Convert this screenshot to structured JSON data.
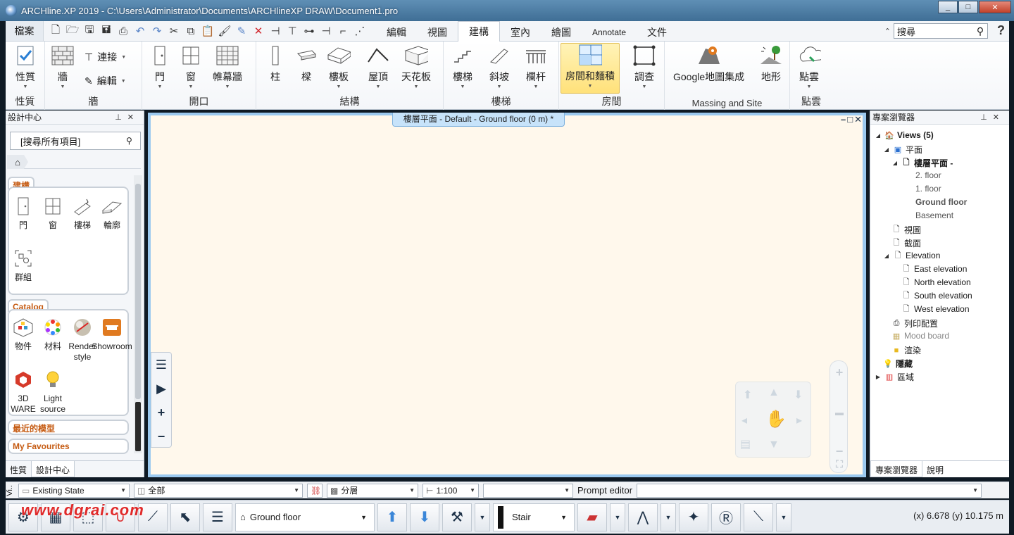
{
  "window": {
    "title": "ARCHline.XP 2019 -  C:\\Users\\Administrator\\Documents\\ARCHlineXP DRAW\\Document1.pro",
    "controls": [
      "_",
      "□",
      "✕"
    ]
  },
  "menubar": {
    "file": "檔案",
    "tabs": [
      "編輯",
      "視圖",
      "建構",
      "室內",
      "繪圖",
      "Annotate",
      "文件"
    ],
    "active_tab": "建構",
    "search_placeholder": "搜尋",
    "help": "?"
  },
  "ribbon": {
    "groups": {
      "props": {
        "label": "性質",
        "btn": "性質"
      },
      "wall": {
        "label": "牆",
        "btn": "牆",
        "connect": "連接",
        "edit": "編輯"
      },
      "opening": {
        "label": "開口",
        "door": "門",
        "window": "窗",
        "curtain": "帷幕牆"
      },
      "structure": {
        "label": "結構",
        "column": "柱",
        "beam": "樑",
        "slab": "樓板",
        "roof": "屋頂",
        "ceiling": "天花板"
      },
      "stair": {
        "label": "樓梯",
        "stair": "樓梯",
        "ramp": "斜坡",
        "railing": "欄杆"
      },
      "room": {
        "label": "房間",
        "room_area": "房間和麵積",
        "survey": "調查"
      },
      "massing": {
        "label": "Massing and Site",
        "google": "Google地圖集成",
        "terrain": "地形"
      },
      "cloud": {
        "label": "點雲",
        "btn": "點雲"
      }
    }
  },
  "left_panel": {
    "title": "設計中心",
    "search": "[搜尋所有項目]",
    "sections": {
      "build": {
        "tab": "建構",
        "items": [
          "門",
          "窗",
          "樓梯",
          "輪廓",
          "群組"
        ]
      },
      "catalog": {
        "tab": "Catalog",
        "items": [
          "物件",
          "材料",
          "Render style",
          "Showroom",
          "3D WARE",
          "Light source"
        ]
      },
      "recent": "最近的模型",
      "favourites": "My Favourites"
    },
    "bottom_tabs": [
      "性質",
      "設計中心"
    ]
  },
  "canvas": {
    "view_title": "樓層平面 - Default - Ground floor (0 m) *",
    "view_ctrls": "–□✕"
  },
  "right_panel": {
    "title": "專案瀏覽器",
    "tree": {
      "views": "Views (5)",
      "plan": "平面",
      "floor_plan": "樓層平面 -",
      "floors": [
        "2. floor",
        "1. floor",
        "Ground floor",
        "Basement"
      ],
      "view": "視圖",
      "section": "截面",
      "elevation": "Elevation",
      "elevations": [
        "East elevation",
        "North elevation",
        "South elevation",
        "West elevation"
      ],
      "print_layout": "列印配置",
      "mood_board": "Mood board",
      "render": "渲染",
      "hidden": "隱藏",
      "zone": "區域"
    },
    "bottom_tabs": [
      "專案瀏覽器",
      "說明"
    ]
  },
  "propbar": {
    "vlabel": "Vi..",
    "state": "Existing State",
    "all": "全部",
    "layer": "分層",
    "scale": "1:100",
    "prompt": "Prompt editor"
  },
  "toolbar": {
    "floor": "Ground floor",
    "stair_type": "Stair",
    "coords": "(x) 6.678   (y) 10.175 m"
  },
  "watermark": "www.dgrai.com"
}
